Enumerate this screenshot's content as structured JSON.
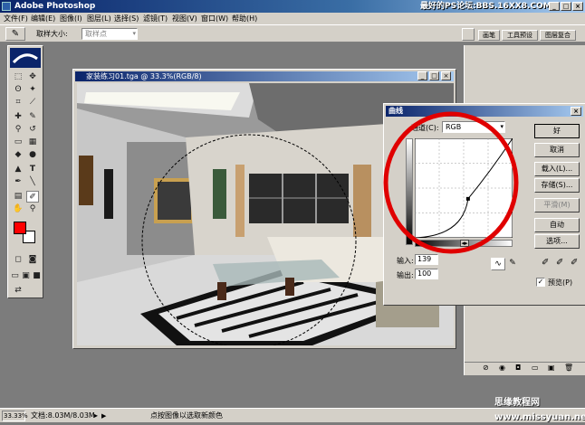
{
  "app": {
    "title": "Adobe Photoshop",
    "watermark": "最好的PS论坛:BBS.16XX8.COM"
  },
  "menu": [
    "文件(F)",
    "编辑(E)",
    "图像(I)",
    "图层(L)",
    "选择(S)",
    "滤镜(T)",
    "视图(V)",
    "窗口(W)",
    "帮助(H)"
  ],
  "options": {
    "sample_label": "取样大小:",
    "sample_value": "取样点"
  },
  "palette_tabs": [
    "画笔",
    "工具预设",
    "图层复合"
  ],
  "document": {
    "title": "家装练习01.tga @ 33.3%(RGB/8)"
  },
  "curves": {
    "title": "曲线",
    "channel_label": "通道(C):",
    "channel_value": "RGB",
    "input_label": "输入:",
    "input_value": "139",
    "output_label": "输出:",
    "output_value": "100",
    "buttons": {
      "ok": "好",
      "cancel": "取消",
      "load": "载入(L)...",
      "save": "存储(S)...",
      "smooth": "平滑(M)",
      "auto": "自动",
      "options": "选项..."
    },
    "preview_label": "预览(P)",
    "preview_checked": true,
    "control_point": {
      "input": 139,
      "output": 100
    }
  },
  "status": {
    "zoom": "33.33%",
    "doc": "文档:8.03M/8.03M",
    "hint": "点按图像以选取新颜色"
  },
  "bottom_watermark": "思缘教程网 www.missyuan.net",
  "colors": {
    "foreground": "#ff0000",
    "background": "#ffffff",
    "highlight_circle": "#e00000"
  }
}
